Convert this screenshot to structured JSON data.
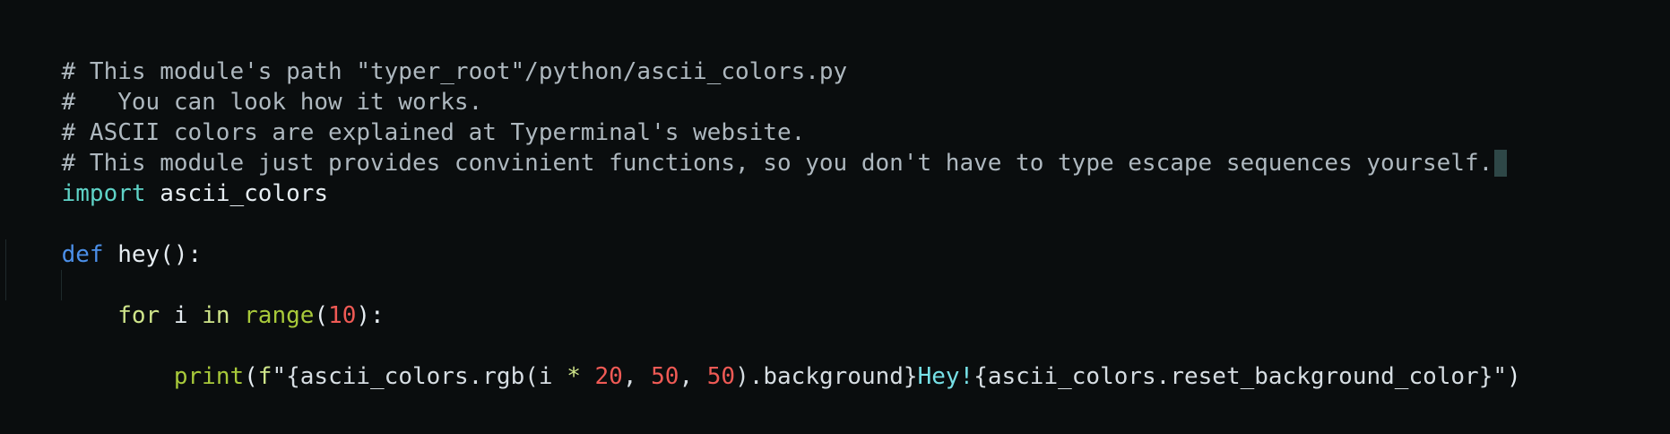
{
  "editor": {
    "lines": [
      {
        "comment": "# This module's path \"typer_root\"/python/ascii_colors.py"
      },
      {
        "comment": "#   You can look how it works."
      },
      {
        "comment": "# ASCII colors are explained at Typerminal's website."
      },
      {
        "comment": "# This module just provides convinient functions, so you don't have to type escape sequences yourself."
      },
      {
        "kw": "import",
        "name": " ascii_colors"
      },
      {},
      {
        "kw": "def",
        "fn": " hey",
        "rest": "():"
      },
      {
        "indent": "    ",
        "kw": "for",
        "vars": " i ",
        "kw2": "in",
        "space": " ",
        "builtin": "range",
        "open": "(",
        "num": "10",
        "close": "):"
      },
      {
        "indent": "        ",
        "fn": "print",
        "open": "(",
        "prefix": "f",
        "q1": "\"",
        "part1": "{ascii_colors.rgb(i ",
        "op": "*",
        "sp1": " ",
        "n1": "20",
        "c1": ", ",
        "n2": "50",
        "c2": ", ",
        "n3": "50",
        "part2": ").background}",
        "literal": "Hey!",
        "part3": "{ascii_colors.reset_background_color}",
        "q2": "\"",
        "close": ")"
      }
    ]
  },
  "colors": {
    "background": "#0a0d0e",
    "comment": "#aeb8bf",
    "keyword_import": "#5fd3c7",
    "keyword_def": "#4b8fe8",
    "keyword_for": "#cfe58a",
    "builtin": "#a8c93a",
    "number": "#ef5a55",
    "literal": "#76e0e6",
    "cursor": "#2e4747"
  }
}
